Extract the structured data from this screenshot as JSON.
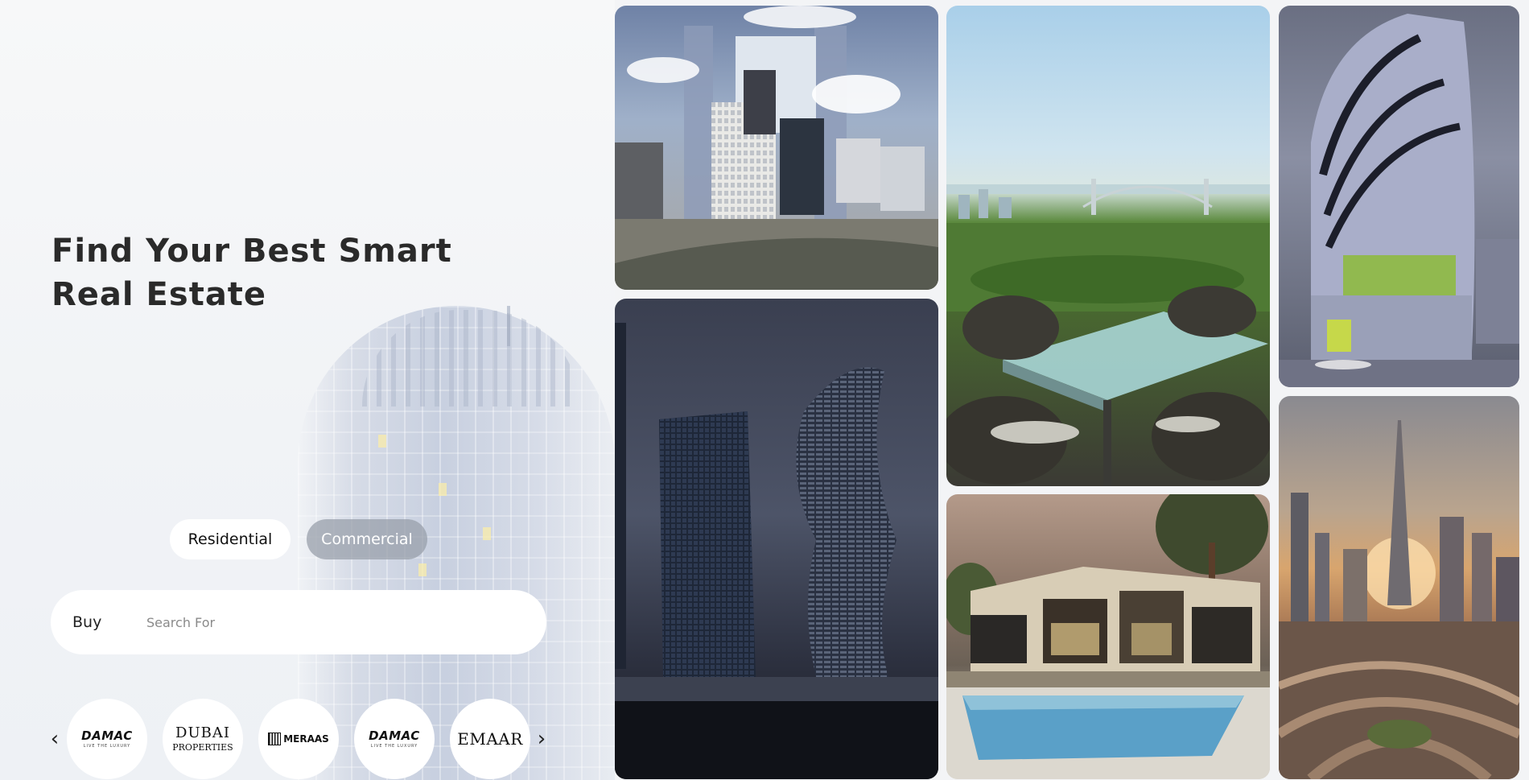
{
  "hero": {
    "title_line1": "Find Your Best Smart",
    "title_line2": "Real Estate"
  },
  "tabs": {
    "residential": "Residential",
    "commercial": "Commercial",
    "active": "Residential"
  },
  "search": {
    "type_label": "Buy",
    "value": "",
    "placeholder": "Search For"
  },
  "developers": {
    "prev_arrow": "‹",
    "next_arrow": "›",
    "items": [
      {
        "name": "DAMAC",
        "tagline": "LIVE THE LUXURY"
      },
      {
        "name": "DUBAI",
        "subname": "PROPERTIES"
      },
      {
        "name": "MERAAS"
      },
      {
        "name": "DAMAC",
        "tagline": "LIVE THE LUXURY"
      },
      {
        "name": "EMAAR"
      }
    ]
  },
  "colors": {
    "title": "#2a2a2a",
    "pill_active_bg": "#ffffff",
    "pill_inactive_bg": "#969ca8",
    "search_bg": "#ffffff"
  },
  "icons": {
    "prev": "chevron-left-icon",
    "next": "chevron-right-icon"
  }
}
